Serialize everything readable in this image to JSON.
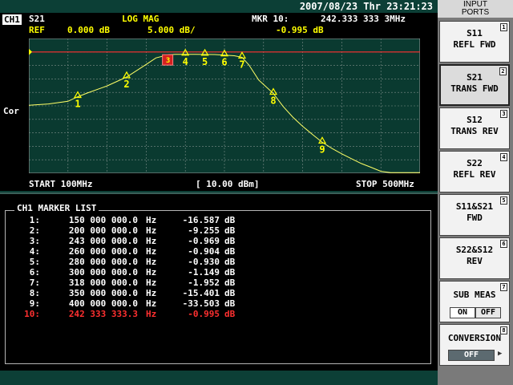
{
  "status": {
    "datetime": "2007/08/23 Thr 23:21:23"
  },
  "trace_header": {
    "channel": "CH1",
    "parameter": "S21",
    "format": "LOG MAG",
    "marker_label": "MKR 10:",
    "marker_freq": "242.333 333 3MHz",
    "ref_label": "REF",
    "ref_value": "0.000 dB",
    "scale": "5.000 dB/",
    "marker_value": "-0.995 dB",
    "cor": "Cor"
  },
  "footer": {
    "start": "START 100MHz",
    "power": "[ 10.00 dBm]",
    "stop": "STOP 500MHz"
  },
  "chart_data": {
    "type": "line",
    "x_range": [
      100,
      500
    ],
    "x_unit": "MHz",
    "y_range": [
      -45,
      5
    ],
    "y_unit": "dB",
    "ref_level": 0,
    "grid": true,
    "trace_color": "#ffff66",
    "ref_color": "#ff3030",
    "trace": {
      "x": [
        100,
        120,
        140,
        150,
        160,
        180,
        200,
        220,
        230,
        243,
        250,
        260,
        270,
        280,
        290,
        300,
        310,
        318,
        325,
        335,
        350,
        360,
        370,
        380,
        390,
        400,
        410,
        420,
        430,
        440,
        450,
        460,
        470,
        480,
        490,
        500
      ],
      "y": [
        -19.8,
        -19.3,
        -18.3,
        -16.6,
        -15.2,
        -12.6,
        -9.3,
        -4.6,
        -2.2,
        -0.97,
        -0.9,
        -0.9,
        -0.9,
        -0.93,
        -0.95,
        -1.15,
        -1.4,
        -1.95,
        -4.8,
        -10.4,
        -15.4,
        -20.2,
        -24.2,
        -27.6,
        -30.6,
        -33.5,
        -35.8,
        -37.8,
        -39.6,
        -41.4,
        -42.8,
        -44.3,
        -44.8,
        -44.8,
        -44.8,
        -44.8
      ]
    },
    "markers": [
      {
        "label": "1",
        "x": 150,
        "y": -16.587
      },
      {
        "label": "2",
        "x": 200,
        "y": -9.255
      },
      {
        "label": "3",
        "x": 243,
        "y": -0.969
      },
      {
        "label": "4",
        "x": 260,
        "y": -0.904
      },
      {
        "label": "5",
        "x": 280,
        "y": -0.93
      },
      {
        "label": "6",
        "x": 300,
        "y": -1.149
      },
      {
        "label": "7",
        "x": 318,
        "y": -1.952
      },
      {
        "label": "8",
        "x": 350,
        "y": -15.401
      },
      {
        "label": "9",
        "x": 400,
        "y": -33.503
      },
      {
        "label": "10",
        "x": 242.333,
        "y": -0.995,
        "active": true
      }
    ]
  },
  "marker_list": {
    "title": "CH1 MARKER LIST",
    "rows": [
      {
        "idx": "1:",
        "freq": "150 000 000.0",
        "unit": "Hz",
        "val": "-16.587",
        "vunit": "dB"
      },
      {
        "idx": "2:",
        "freq": "200 000 000.0",
        "unit": "Hz",
        "val": "-9.255",
        "vunit": "dB"
      },
      {
        "idx": "3:",
        "freq": "243 000 000.0",
        "unit": "Hz",
        "val": "-0.969",
        "vunit": "dB"
      },
      {
        "idx": "4:",
        "freq": "260 000 000.0",
        "unit": "Hz",
        "val": "-0.904",
        "vunit": "dB"
      },
      {
        "idx": "5:",
        "freq": "280 000 000.0",
        "unit": "Hz",
        "val": "-0.930",
        "vunit": "dB"
      },
      {
        "idx": "6:",
        "freq": "300 000 000.0",
        "unit": "Hz",
        "val": "-1.149",
        "vunit": "dB"
      },
      {
        "idx": "7:",
        "freq": "318 000 000.0",
        "unit": "Hz",
        "val": "-1.952",
        "vunit": "dB"
      },
      {
        "idx": "8:",
        "freq": "350 000 000.0",
        "unit": "Hz",
        "val": "-15.401",
        "vunit": "dB"
      },
      {
        "idx": "9:",
        "freq": "400 000 000.0",
        "unit": "Hz",
        "val": "-33.503",
        "vunit": "dB"
      },
      {
        "idx": "10:",
        "freq": "242 333 333.3",
        "unit": "Hz",
        "val": "-0.995",
        "vunit": "dB",
        "active": true
      }
    ]
  },
  "softkeys": {
    "header_line1": "INPUT",
    "header_line2": "PORTS",
    "keys": [
      {
        "num": "1",
        "line1": "S11",
        "line2": "REFL FWD"
      },
      {
        "num": "2",
        "line1": "S21",
        "line2": "TRANS FWD",
        "selected": true
      },
      {
        "num": "3",
        "line1": "S12",
        "line2": "TRANS REV"
      },
      {
        "num": "4",
        "line1": "S22",
        "line2": "REFL REV"
      },
      {
        "num": "5",
        "line1": "S11&S21",
        "line2": "FWD"
      },
      {
        "num": "6",
        "line1": "S22&S12",
        "line2": "REV"
      }
    ],
    "sub_meas": {
      "num": "7",
      "label": "SUB MEAS",
      "on": "ON",
      "off": "OFF"
    },
    "conversion": {
      "num": "8",
      "label": "CONVERSION",
      "value": "OFF"
    }
  }
}
